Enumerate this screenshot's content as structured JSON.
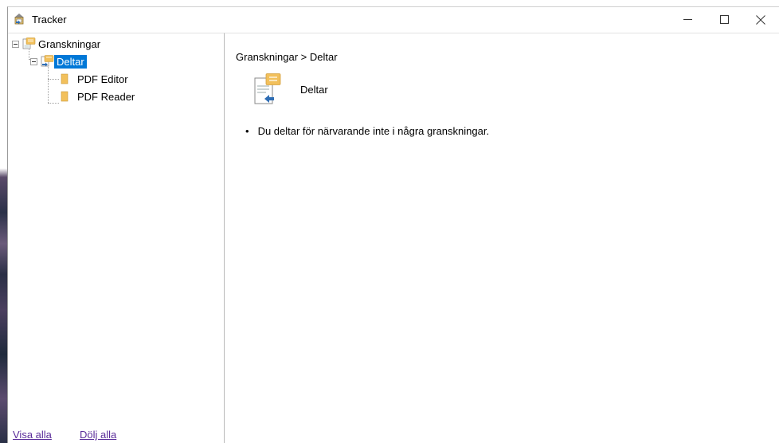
{
  "window": {
    "title": "Tracker"
  },
  "tree": {
    "root": "Granskningar",
    "selected": "Deltar",
    "children": [
      "PDF Editor",
      "PDF Reader"
    ]
  },
  "footer": {
    "show_all": "Visa alla",
    "hide_all": "Dölj alla"
  },
  "content": {
    "breadcrumb": "Granskningar > Deltar",
    "header_title": "Deltar",
    "message": "Du deltar för närvarande inte i några granskningar.",
    "bullet": "•"
  },
  "colors": {
    "selection": "#0078d7",
    "link": "#5b2d9a"
  }
}
